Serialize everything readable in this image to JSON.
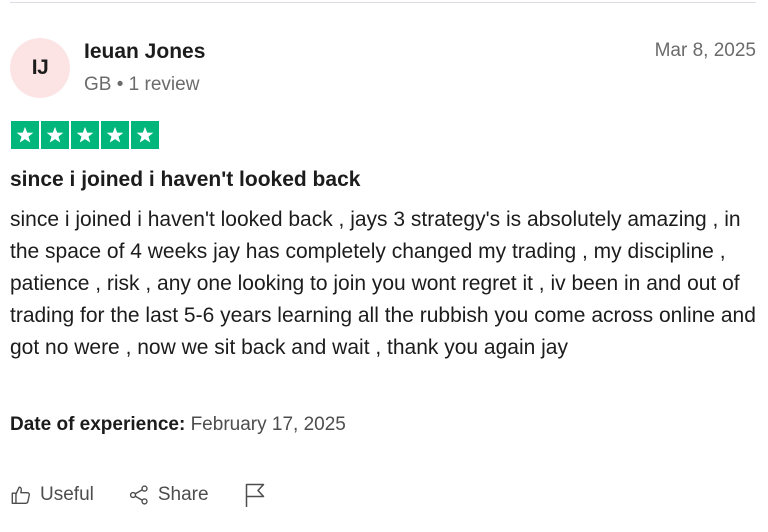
{
  "reviewer": {
    "initials": "IJ",
    "name": "Ieuan Jones",
    "country": "GB",
    "separator": "•",
    "review_count": "1 review"
  },
  "review": {
    "date": "Mar 8, 2025",
    "rating": 5,
    "rating_max": 5,
    "star_color": "#00b67a",
    "title": "since i joined i haven't looked back",
    "body": "since i joined i haven't looked back , jays 3 strategy's is absolutely amazing , in the space of 4 weeks jay has completely changed my trading , my discipline , patience , risk , any one looking to join you wont regret it , iv been in and out of trading for the last 5-6 years learning all the rubbish you come across online and got no were , now we sit back and wait , thank you again jay",
    "experience_label": "Date of experience:",
    "experience_date": "February 17, 2025"
  },
  "actions": {
    "useful_label": "Useful",
    "useful_icon": "thumbs-up-icon",
    "share_label": "Share",
    "share_icon": "share-icon",
    "report_icon": "flag-icon"
  },
  "colors": {
    "avatar_bg": "#fde4e4",
    "muted_text": "#6b6b6b"
  }
}
